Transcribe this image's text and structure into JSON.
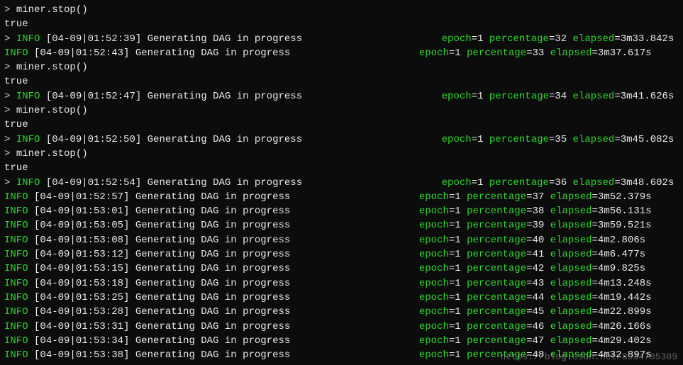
{
  "cmd": "miner.stop()",
  "result": "true",
  "prompt": ">",
  "watermark": "https://blog.csdn.net/8934785309",
  "msg": "Generating DAG in progress",
  "label_info": "INFO",
  "label_epoch": "epoch",
  "label_percentage": "percentage",
  "label_elapsed": "elapsed",
  "logs": [
    {
      "ts": "[04-09|01:52:39]",
      "epoch": "1",
      "pct": "32",
      "elapsed": "3m33.842s",
      "leading_prompt": true
    },
    {
      "ts": "[04-09|01:52:43]",
      "epoch": "1",
      "pct": "33",
      "elapsed": "3m37.617s",
      "leading_prompt": false
    },
    {
      "ts": "[04-09|01:52:47]",
      "epoch": "1",
      "pct": "34",
      "elapsed": "3m41.626s",
      "leading_prompt": true
    },
    {
      "ts": "[04-09|01:52:50]",
      "epoch": "1",
      "pct": "35",
      "elapsed": "3m45.082s",
      "leading_prompt": true
    },
    {
      "ts": "[04-09|01:52:54]",
      "epoch": "1",
      "pct": "36",
      "elapsed": "3m48.602s",
      "leading_prompt": true
    },
    {
      "ts": "[04-09|01:52:57]",
      "epoch": "1",
      "pct": "37",
      "elapsed": "3m52.379s",
      "leading_prompt": false
    },
    {
      "ts": "[04-09|01:53:01]",
      "epoch": "1",
      "pct": "38",
      "elapsed": "3m56.131s",
      "leading_prompt": false
    },
    {
      "ts": "[04-09|01:53:05]",
      "epoch": "1",
      "pct": "39",
      "elapsed": "3m59.521s",
      "leading_prompt": false
    },
    {
      "ts": "[04-09|01:53:08]",
      "epoch": "1",
      "pct": "40",
      "elapsed": "4m2.806s",
      "leading_prompt": false
    },
    {
      "ts": "[04-09|01:53:12]",
      "epoch": "1",
      "pct": "41",
      "elapsed": "4m6.477s",
      "leading_prompt": false
    },
    {
      "ts": "[04-09|01:53:15]",
      "epoch": "1",
      "pct": "42",
      "elapsed": "4m9.825s",
      "leading_prompt": false
    },
    {
      "ts": "[04-09|01:53:18]",
      "epoch": "1",
      "pct": "43",
      "elapsed": "4m13.248s",
      "leading_prompt": false
    },
    {
      "ts": "[04-09|01:53:25]",
      "epoch": "1",
      "pct": "44",
      "elapsed": "4m19.442s",
      "leading_prompt": false
    },
    {
      "ts": "[04-09|01:53:28]",
      "epoch": "1",
      "pct": "45",
      "elapsed": "4m22.899s",
      "leading_prompt": false
    },
    {
      "ts": "[04-09|01:53:31]",
      "epoch": "1",
      "pct": "46",
      "elapsed": "4m26.166s",
      "leading_prompt": false
    },
    {
      "ts": "[04-09|01:53:34]",
      "epoch": "1",
      "pct": "47",
      "elapsed": "4m29.402s",
      "leading_prompt": false
    },
    {
      "ts": "[04-09|01:53:38]",
      "epoch": "1",
      "pct": "48",
      "elapsed": "4m32.897s",
      "leading_prompt": false
    }
  ],
  "sequence": [
    {
      "type": "cmd"
    },
    {
      "type": "result"
    },
    {
      "type": "log",
      "i": 0
    },
    {
      "type": "log",
      "i": 1
    },
    {
      "type": "cmd"
    },
    {
      "type": "result"
    },
    {
      "type": "log",
      "i": 2
    },
    {
      "type": "cmd"
    },
    {
      "type": "result"
    },
    {
      "type": "log",
      "i": 3
    },
    {
      "type": "cmd"
    },
    {
      "type": "result"
    },
    {
      "type": "log",
      "i": 4
    },
    {
      "type": "log",
      "i": 5
    },
    {
      "type": "log",
      "i": 6
    },
    {
      "type": "log",
      "i": 7
    },
    {
      "type": "log",
      "i": 8
    },
    {
      "type": "log",
      "i": 9
    },
    {
      "type": "log",
      "i": 10
    },
    {
      "type": "log",
      "i": 11
    },
    {
      "type": "log",
      "i": 12
    },
    {
      "type": "log",
      "i": 13
    },
    {
      "type": "log",
      "i": 14
    },
    {
      "type": "log",
      "i": 15
    },
    {
      "type": "log",
      "i": 16
    }
  ]
}
